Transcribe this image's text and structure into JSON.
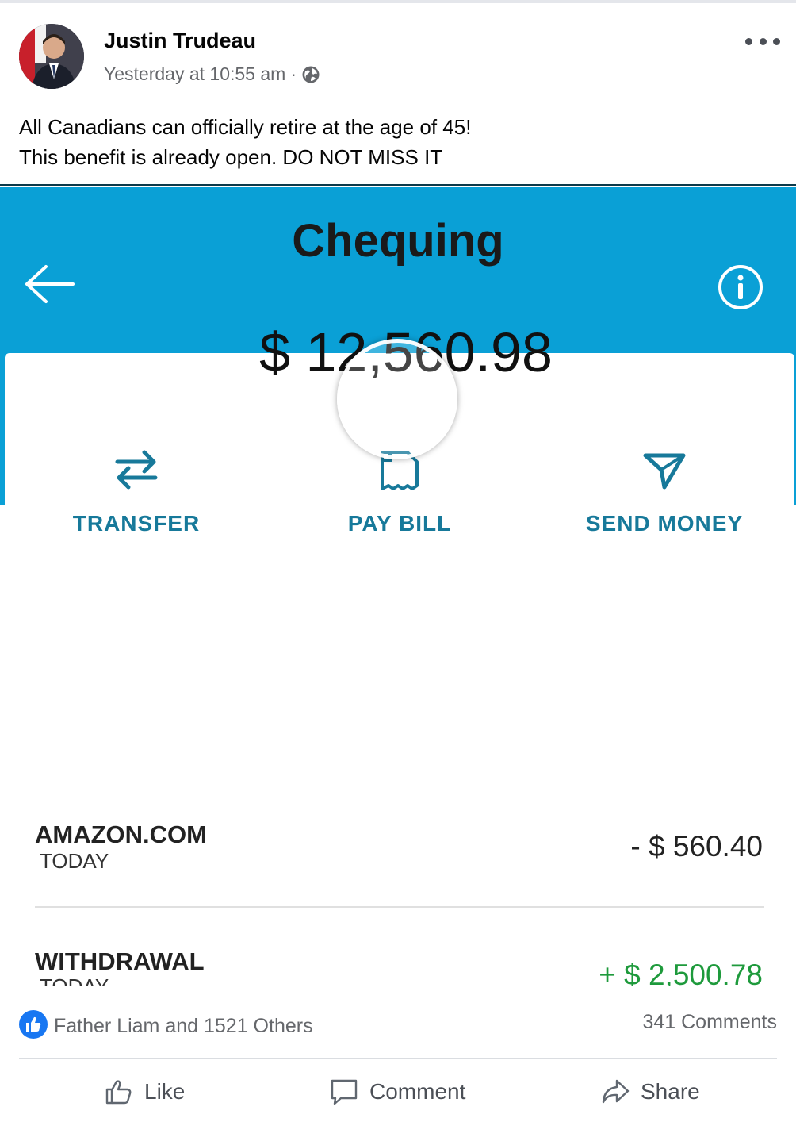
{
  "post": {
    "author": "Justin Trudeau",
    "timestamp": "Yesterday at 10:55 am",
    "separator": "·",
    "audience_icon": "globe-icon",
    "text_line1": "All Canadians can officially retire at the age of 45!",
    "text_line2": "This benefit is already open. DO NOT MISS IT"
  },
  "media": {
    "header_color": "#0aa0d6",
    "account_title": "Chequing",
    "balance": "$ 12,560.98",
    "actions": [
      {
        "label": "TRANSFER",
        "icon": "transfer-icon"
      },
      {
        "label": "PAY BILL",
        "icon": "bill-icon"
      },
      {
        "label": "SEND MONEY",
        "icon": "send-icon"
      }
    ],
    "transactions": [
      {
        "name": "AMAZON.COM",
        "date": "TODAY",
        "amount": "- $ 560.40"
      },
      {
        "name": "WITHDRAWAL",
        "date": "TODAY",
        "amount": "+ $ 2,500.78"
      }
    ]
  },
  "reactions": {
    "summary": "Father Liam and 1521 Others",
    "comments": "341 Comments"
  },
  "action_bar": {
    "like": "Like",
    "comment": "Comment",
    "share": "Share"
  }
}
